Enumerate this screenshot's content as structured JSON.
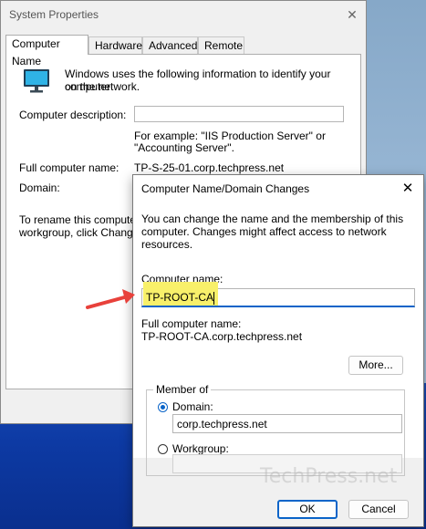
{
  "system_properties": {
    "title": "System Properties",
    "tabs": [
      {
        "label": "Computer Name",
        "active": true
      },
      {
        "label": "Hardware",
        "active": false
      },
      {
        "label": "Advanced",
        "active": false
      },
      {
        "label": "Remote",
        "active": false
      }
    ],
    "intro_line1": "Windows uses the following information to identify your computer",
    "intro_line2": "on the network.",
    "description_label": "Computer description:",
    "example_line1": "For example: \"IIS Production Server\" or",
    "example_line2": "\"Accounting Server\".",
    "full_name_label": "Full computer name:",
    "full_name_value": "TP-S-25-01.corp.techpress.net",
    "domain_label": "Domain:",
    "rename_line1": "To rename this computer o",
    "rename_line2": "workgroup, click Change."
  },
  "dialog": {
    "title": "Computer Name/Domain Changes",
    "intro_line1": "You can change the name and the membership of this",
    "intro_line2": "computer. Changes might affect access to network resources.",
    "computer_name_label": "Computer name:",
    "computer_name_value": "TP-ROOT-CA",
    "full_name_label": "Full computer name:",
    "full_name_value": "TP-ROOT-CA.corp.techpress.net",
    "more_button": "More...",
    "member_of_label": "Member of",
    "domain_option": "Domain:",
    "domain_value": "corp.techpress.net",
    "workgroup_option": "Workgroup:",
    "workgroup_value": "",
    "ok_button": "OK",
    "cancel_button": "Cancel"
  },
  "watermark": "TechPress.net",
  "colors": {
    "accent": "#0a64c8",
    "highlight": "#f8f06a",
    "annotation_arrow": "#e8413b"
  }
}
